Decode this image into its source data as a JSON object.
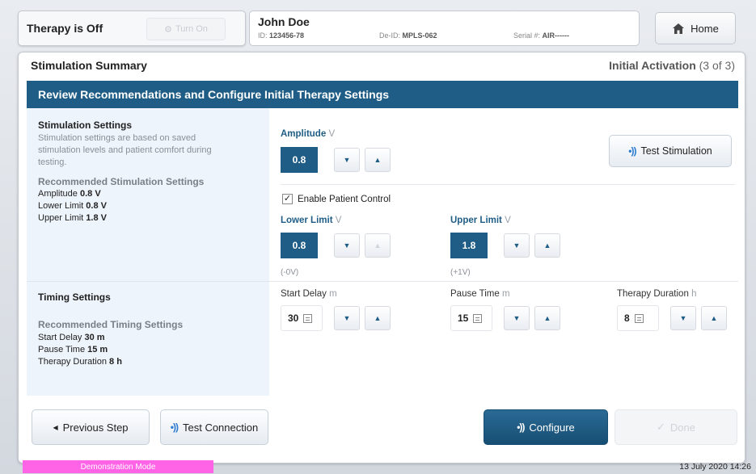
{
  "header": {
    "therapy_status": "Therapy is Off",
    "turn_on_label": "Turn On",
    "patient_name": "John Doe",
    "patient_id_label": "ID: ",
    "patient_id": "123456-78",
    "deid_label": "De-ID: ",
    "deid": "MPLS-062",
    "serial_label": "Serial #: ",
    "serial": "AIR------",
    "home_label": "Home"
  },
  "page": {
    "title": "Stimulation Summary",
    "step_label": "Initial Activation",
    "step_progress": "(3 of 3)",
    "banner": "Review Recommendations and Configure Initial Therapy Settings"
  },
  "stimulation": {
    "title": "Stimulation Settings",
    "description_line1": "Stimulation settings are based on saved",
    "description_line2": "stimulation levels and patient comfort during",
    "description_line3": "testing.",
    "rec_title": "Recommended Stimulation Settings",
    "rec": [
      {
        "label": "Amplitude ",
        "value": "0.8 V"
      },
      {
        "label": "Lower Limit ",
        "value": "0.8 V"
      },
      {
        "label": "Upper Limit ",
        "value": "1.8 V"
      }
    ],
    "amplitude_label": "Amplitude",
    "amplitude_unit": "V",
    "amplitude_value": "0.8",
    "test_stim_label": "Test Stimulation",
    "enable_patient_control": "Enable Patient Control",
    "lower_label": "Lower Limit",
    "lower_unit": "V",
    "lower_value": "0.8",
    "lower_hint": "(-0V)",
    "upper_label": "Upper Limit",
    "upper_unit": "V",
    "upper_value": "1.8",
    "upper_hint": "(+1V)"
  },
  "timing": {
    "title": "Timing Settings",
    "rec_title": "Recommended Timing Settings",
    "rec": [
      {
        "label": "Start Delay ",
        "value": "30 m"
      },
      {
        "label": "Pause Time ",
        "value": "15 m"
      },
      {
        "label": "Therapy Duration ",
        "value": "8 h"
      }
    ],
    "start_delay_label": "Start Delay",
    "start_delay_unit": "m",
    "start_delay_value": "30",
    "pause_time_label": "Pause Time",
    "pause_time_unit": "m",
    "pause_time_value": "15",
    "therapy_duration_label": "Therapy Duration",
    "therapy_duration_unit": "h",
    "therapy_duration_value": "8"
  },
  "footer": {
    "previous_label": "Previous Step",
    "test_connection_label": "Test Connection",
    "configure_label": "Configure",
    "done_label": "Done"
  },
  "statusbar": {
    "demo_mode": "Demonstration Mode",
    "datetime": "13 July 2020 14:26"
  },
  "colors": {
    "brand": "#1f5d86",
    "demo": "#ff63e6"
  }
}
